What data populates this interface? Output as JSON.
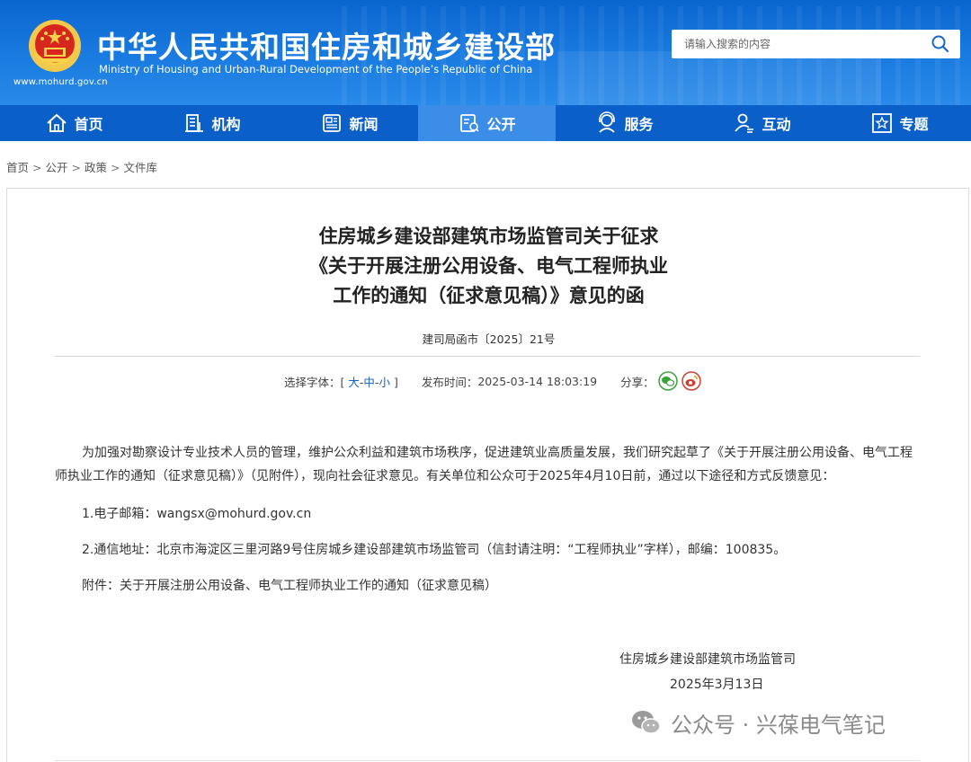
{
  "header": {
    "title_cn": "中华人民共和国住房和城乡建设部",
    "title_en": "Ministry of Housing and Urban-Rural Development of the People’s Republic of China",
    "url": "www.mohurd.gov.cn",
    "search_placeholder": "请输入搜索的内容",
    "brand_color": "#0a66cf"
  },
  "nav": {
    "items": [
      {
        "label": "首页",
        "icon": "home-icon"
      },
      {
        "label": "机构",
        "icon": "building-icon"
      },
      {
        "label": "新闻",
        "icon": "news-icon"
      },
      {
        "label": "公开",
        "icon": "document-icon",
        "active": true
      },
      {
        "label": "服务",
        "icon": "service-icon"
      },
      {
        "label": "互动",
        "icon": "interact-icon"
      },
      {
        "label": "专题",
        "icon": "star-icon"
      }
    ]
  },
  "breadcrumb": {
    "items": [
      "首页",
      "公开",
      "政策",
      "文件库"
    ],
    "sep": ">"
  },
  "article": {
    "title_lines": [
      "住房城乡建设部建筑市场监管司关于征求",
      "《关于开展注册公用设备、电气工程师执业",
      "工作的通知（征求意见稿）》意见的函"
    ],
    "doc_number": "建司局函市〔2025〕21号",
    "font_size_label": "选择字体：",
    "font_size_open": "[",
    "font_sizes": [
      "大",
      "中",
      "小"
    ],
    "font_size_dash": "-",
    "font_size_close": "]",
    "publish_label": "发布时间：",
    "publish_time": "2025-03-14 18:03:19",
    "share_label": "分享：",
    "body": [
      "为加强对勘察设计专业技术人员的管理，维护公众利益和建筑市场秩序，促进建筑业高质量发展，我们研究起草了《关于开展注册公用设备、电气工程师执业工作的通知（征求意见稿）》（见附件），现向社会征求意见。有关单位和公众可于2025年4月10日前，通过以下途径和方式反馈意见：",
      "1.电子邮箱：wangsx@mohurd.gov.cn",
      "2.通信地址：北京市海淀区三里河路9号住房城乡建设部建筑市场监管司（信封请注明：“工程师执业”字样），邮编：100835。",
      "附件：关于开展注册公用设备、电气工程师执业工作的通知（征求意见稿）"
    ],
    "signature": "住房城乡建设部建筑市场监管司",
    "date": "2025年3月13日"
  },
  "watermark": {
    "text": "公众号 · 兴葆电气笔记"
  }
}
